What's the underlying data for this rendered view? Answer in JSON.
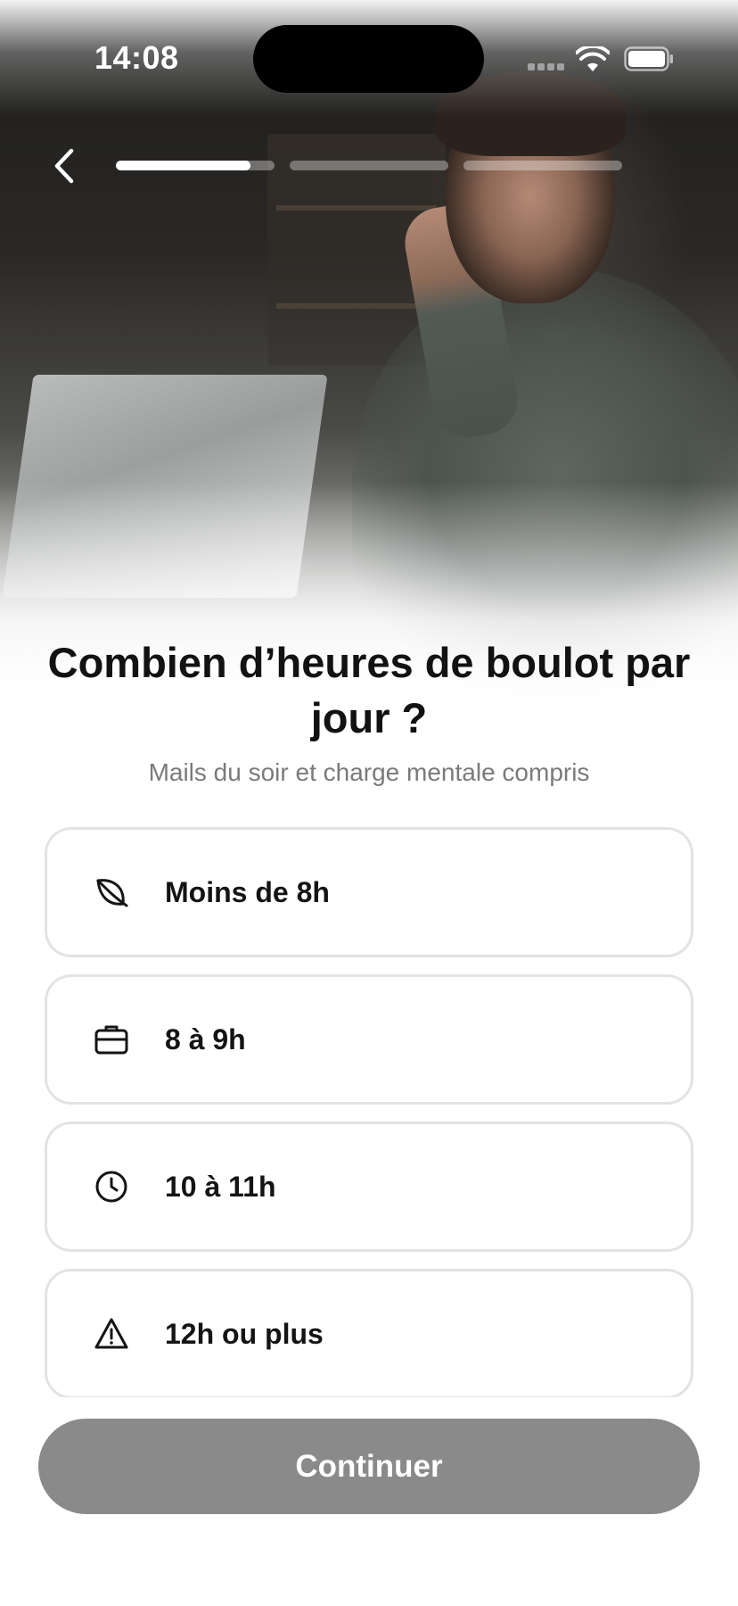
{
  "status_bar": {
    "time": "14:08"
  },
  "nav": {
    "back_icon": "chevron-left-icon",
    "progress": {
      "segments": 3,
      "current_segment": 1,
      "current_segment_fill": 0.85
    }
  },
  "question": {
    "title": "Combien d’heures de boulot par jour ?",
    "subtitle": "Mails du soir et charge mentale compris"
  },
  "options": [
    {
      "label": "Moins de 8h",
      "icon": "leaf-icon"
    },
    {
      "label": "8 à 9h",
      "icon": "briefcase-icon"
    },
    {
      "label": "10 à 11h",
      "icon": "clock-icon"
    },
    {
      "label": "12h ou plus",
      "icon": "warning-icon"
    }
  ],
  "continue_button": {
    "label": "Continuer",
    "state": "disabled"
  },
  "colors": {
    "text_primary": "#121212",
    "text_secondary": "#7a7a7a",
    "option_border": "#e3e3e3",
    "button_disabled": "#8a8a8a",
    "progress_active": "#ffffff"
  }
}
